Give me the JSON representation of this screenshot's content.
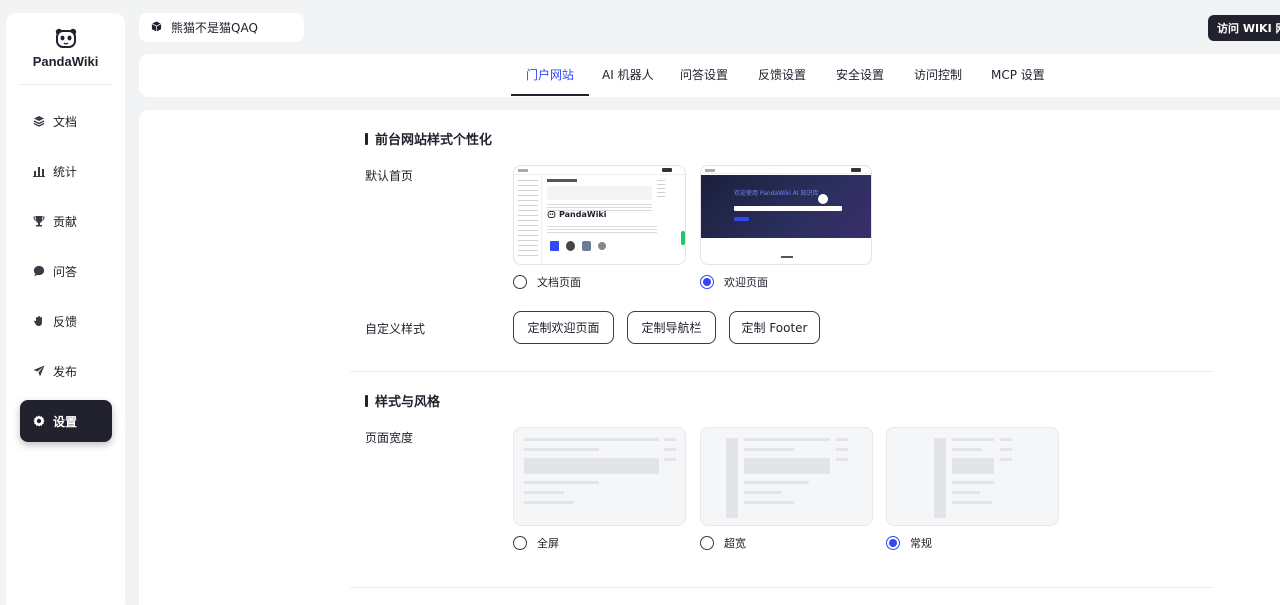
{
  "brand": {
    "name": "PandaWiki"
  },
  "sidebar": {
    "items": [
      {
        "label": "文档",
        "icon": "layers-icon"
      },
      {
        "label": "统计",
        "icon": "bar-chart-icon"
      },
      {
        "label": "贡献",
        "icon": "trophy-icon"
      },
      {
        "label": "问答",
        "icon": "chat-bubble-icon"
      },
      {
        "label": "反馈",
        "icon": "hand-icon"
      },
      {
        "label": "发布",
        "icon": "send-icon"
      },
      {
        "label": "设置",
        "icon": "gear-icon",
        "active": true
      }
    ]
  },
  "workspace": {
    "name": "熊猫不是猫QAQ",
    "icon": "cube-icon"
  },
  "visit_button": "访问 WIKI 网站",
  "tabs": [
    {
      "label": "门户网站",
      "active": true
    },
    {
      "label": "AI 机器人"
    },
    {
      "label": "问答设置"
    },
    {
      "label": "反馈设置"
    },
    {
      "label": "安全设置"
    },
    {
      "label": "访问控制"
    },
    {
      "label": "MCP 设置"
    }
  ],
  "section_style": {
    "title": "前台网站样式个性化",
    "homepage_label": "默认首页",
    "homepage_options": [
      {
        "label": "文档页面",
        "selected": false,
        "preview_brand": "PandaWiki"
      },
      {
        "label": "欢迎页面",
        "selected": true,
        "preview_heading": "欢迎使用 PandaWiki AI 知识库"
      }
    ],
    "custom_label": "自定义样式",
    "custom_buttons": [
      "定制欢迎页面",
      "定制导航栏",
      "定制 Footer"
    ]
  },
  "section_theme": {
    "title": "样式与风格",
    "width_label": "页面宽度",
    "width_options": [
      {
        "label": "全屏",
        "selected": false
      },
      {
        "label": "超宽",
        "selected": false
      },
      {
        "label": "常规",
        "selected": true
      }
    ]
  },
  "colors": {
    "accent": "#3248f2",
    "dark": "#21222d",
    "background": "#f2f3f5"
  }
}
